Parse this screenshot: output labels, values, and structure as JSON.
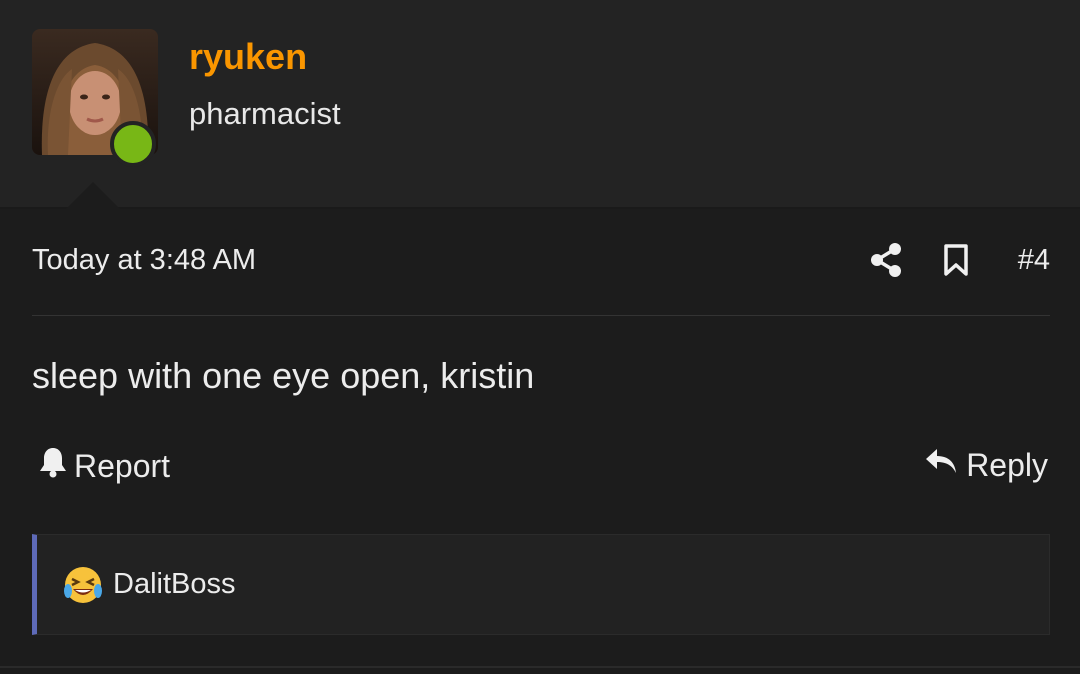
{
  "user": {
    "name": "ryuken",
    "title": "pharmacist",
    "status_color": "#78b716",
    "name_color": "#fa9600"
  },
  "post": {
    "time": "Today at 3:48 AM",
    "number": "#4",
    "body": "sleep with one eye open, kristin"
  },
  "actions": {
    "report_label": "Report",
    "reply_label": "Reply"
  },
  "reactions": {
    "emoji": "laughing-crying-emoji",
    "user": "DalitBoss"
  },
  "icons": {
    "share": "share-icon",
    "bookmark": "bookmark-icon",
    "report": "bell-icon",
    "reply": "reply-arrow-icon"
  }
}
